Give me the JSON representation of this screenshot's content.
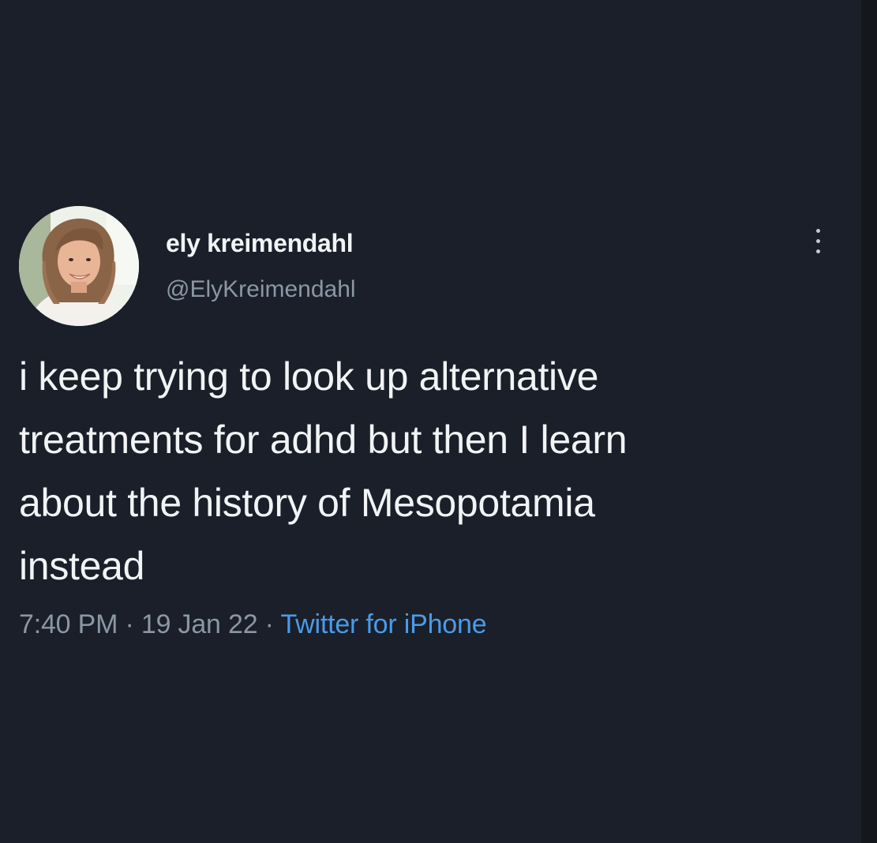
{
  "author": {
    "display_name": "ely kreimendahl",
    "handle": "@ElyKreimendahl"
  },
  "tweet": {
    "lines": [
      "i keep trying to look up alternative",
      "treatments for adhd but then I learn",
      "about the history of Mesopotamia",
      "instead"
    ]
  },
  "meta": {
    "time": "7:40 PM",
    "separator": " · ",
    "date": "19 Jan 22",
    "source": "Twitter for iPhone"
  },
  "icons": {
    "more": "more-vertical-icon"
  },
  "colors": {
    "background": "#1a1f29",
    "text": "#f1f3f5",
    "muted": "#8b97a5",
    "link": "#4a9be8"
  }
}
